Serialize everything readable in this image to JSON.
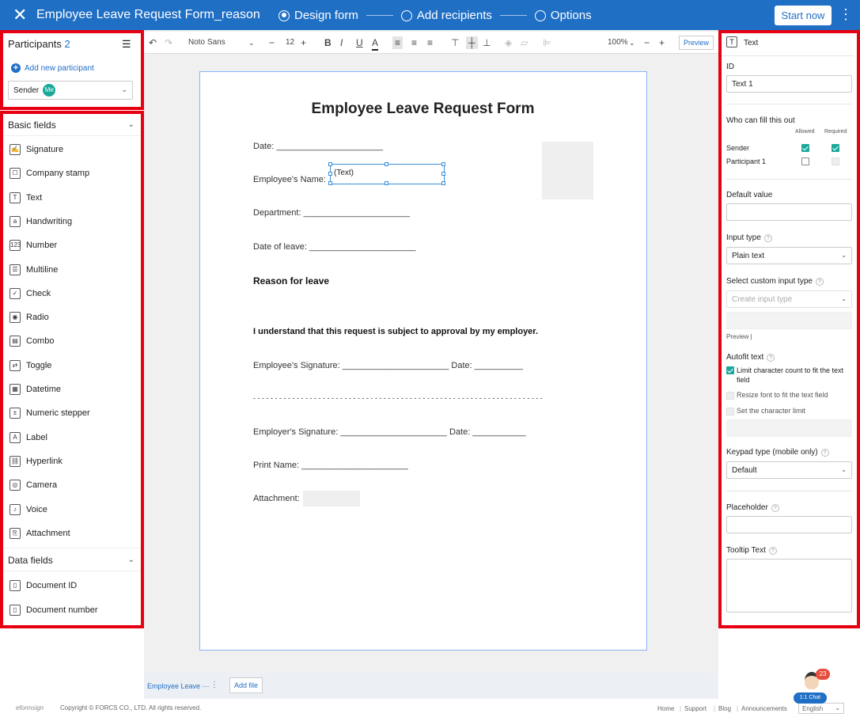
{
  "topbar": {
    "title": "Employee Leave Request Form_reason",
    "steps": [
      "Design form",
      "Add recipients",
      "Options"
    ],
    "start_label": "Start now"
  },
  "participants": {
    "header": "Participants",
    "count": "2",
    "add_label": "Add new participant",
    "selected": "Sender",
    "me_badge": "Me"
  },
  "basic_fields": {
    "header": "Basic fields",
    "items": [
      "Signature",
      "Company stamp",
      "Text",
      "Handwriting",
      "Number",
      "Multiline",
      "Check",
      "Radio",
      "Combo",
      "Toggle",
      "Datetime",
      "Numeric stepper",
      "Label",
      "Hyperlink",
      "Camera",
      "Voice",
      "Attachment"
    ]
  },
  "data_fields": {
    "header": "Data fields",
    "items": [
      "Document ID",
      "Document number"
    ]
  },
  "toolbar": {
    "font": "Noto Sans",
    "size": "12",
    "zoom": "100%",
    "preview": "Preview"
  },
  "document": {
    "title": "Employee Leave Request Form",
    "date": "Date: ______________________",
    "name_label": "Employee's Name:",
    "name_field": "(Text)",
    "department": "Department: ______________________",
    "date_of_leave": "Date of leave: ______________________",
    "reason": "Reason for leave",
    "understand": "I understand that this request is subject to approval by my employer.",
    "emp_sig": "Employee's Signature: ______________________  Date: __________",
    "divider": "- - - - - - - - - - - - - - - - - - - - - - - - - - - - - - - - - - - - - - - - - - - - - - - - - - - - - - - - - - - - - - - - - - -",
    "employer_sig": "Employer's Signature: ______________________  Date: ___________",
    "print_name": "Print Name: ______________________",
    "attachment": "Attachment:"
  },
  "tabs": {
    "doc_tab": "Employee Leave ⋯",
    "add_file": "Add file"
  },
  "props": {
    "header": "Text",
    "id_label": "ID",
    "id_value": "Text 1",
    "who_label": "Who can fill this out",
    "allowed": "Allowed",
    "required": "Required",
    "rows": [
      "Sender",
      "Participant 1"
    ],
    "default_label": "Default value",
    "input_type_label": "Input type",
    "input_type_value": "Plain text",
    "custom_label": "Select custom input type",
    "custom_placeholder": "Create input type",
    "preview_label": "Preview |",
    "autofit_label": "Autofit text",
    "autofit_opts": [
      "Limit character count to fit the text field",
      "Resize font to fit the text field",
      "Set the character limit"
    ],
    "keypad_label": "Keypad type (mobile only)",
    "keypad_value": "Default",
    "placeholder_label": "Placeholder",
    "tooltip_label": "Tooltip Text"
  },
  "footer": {
    "brand": "eformsign",
    "copyright": "Copyright © FORCS CO., LTD. All rights reserved.",
    "links": [
      "Home",
      "Support",
      "Blog",
      "Announcements"
    ],
    "lang": "English",
    "chat_label": "1:1 Chat",
    "chat_badge": "23"
  },
  "colors": {
    "brand": "#1f6fc5",
    "teal": "#1aa89a",
    "highlight": "#e60012"
  }
}
